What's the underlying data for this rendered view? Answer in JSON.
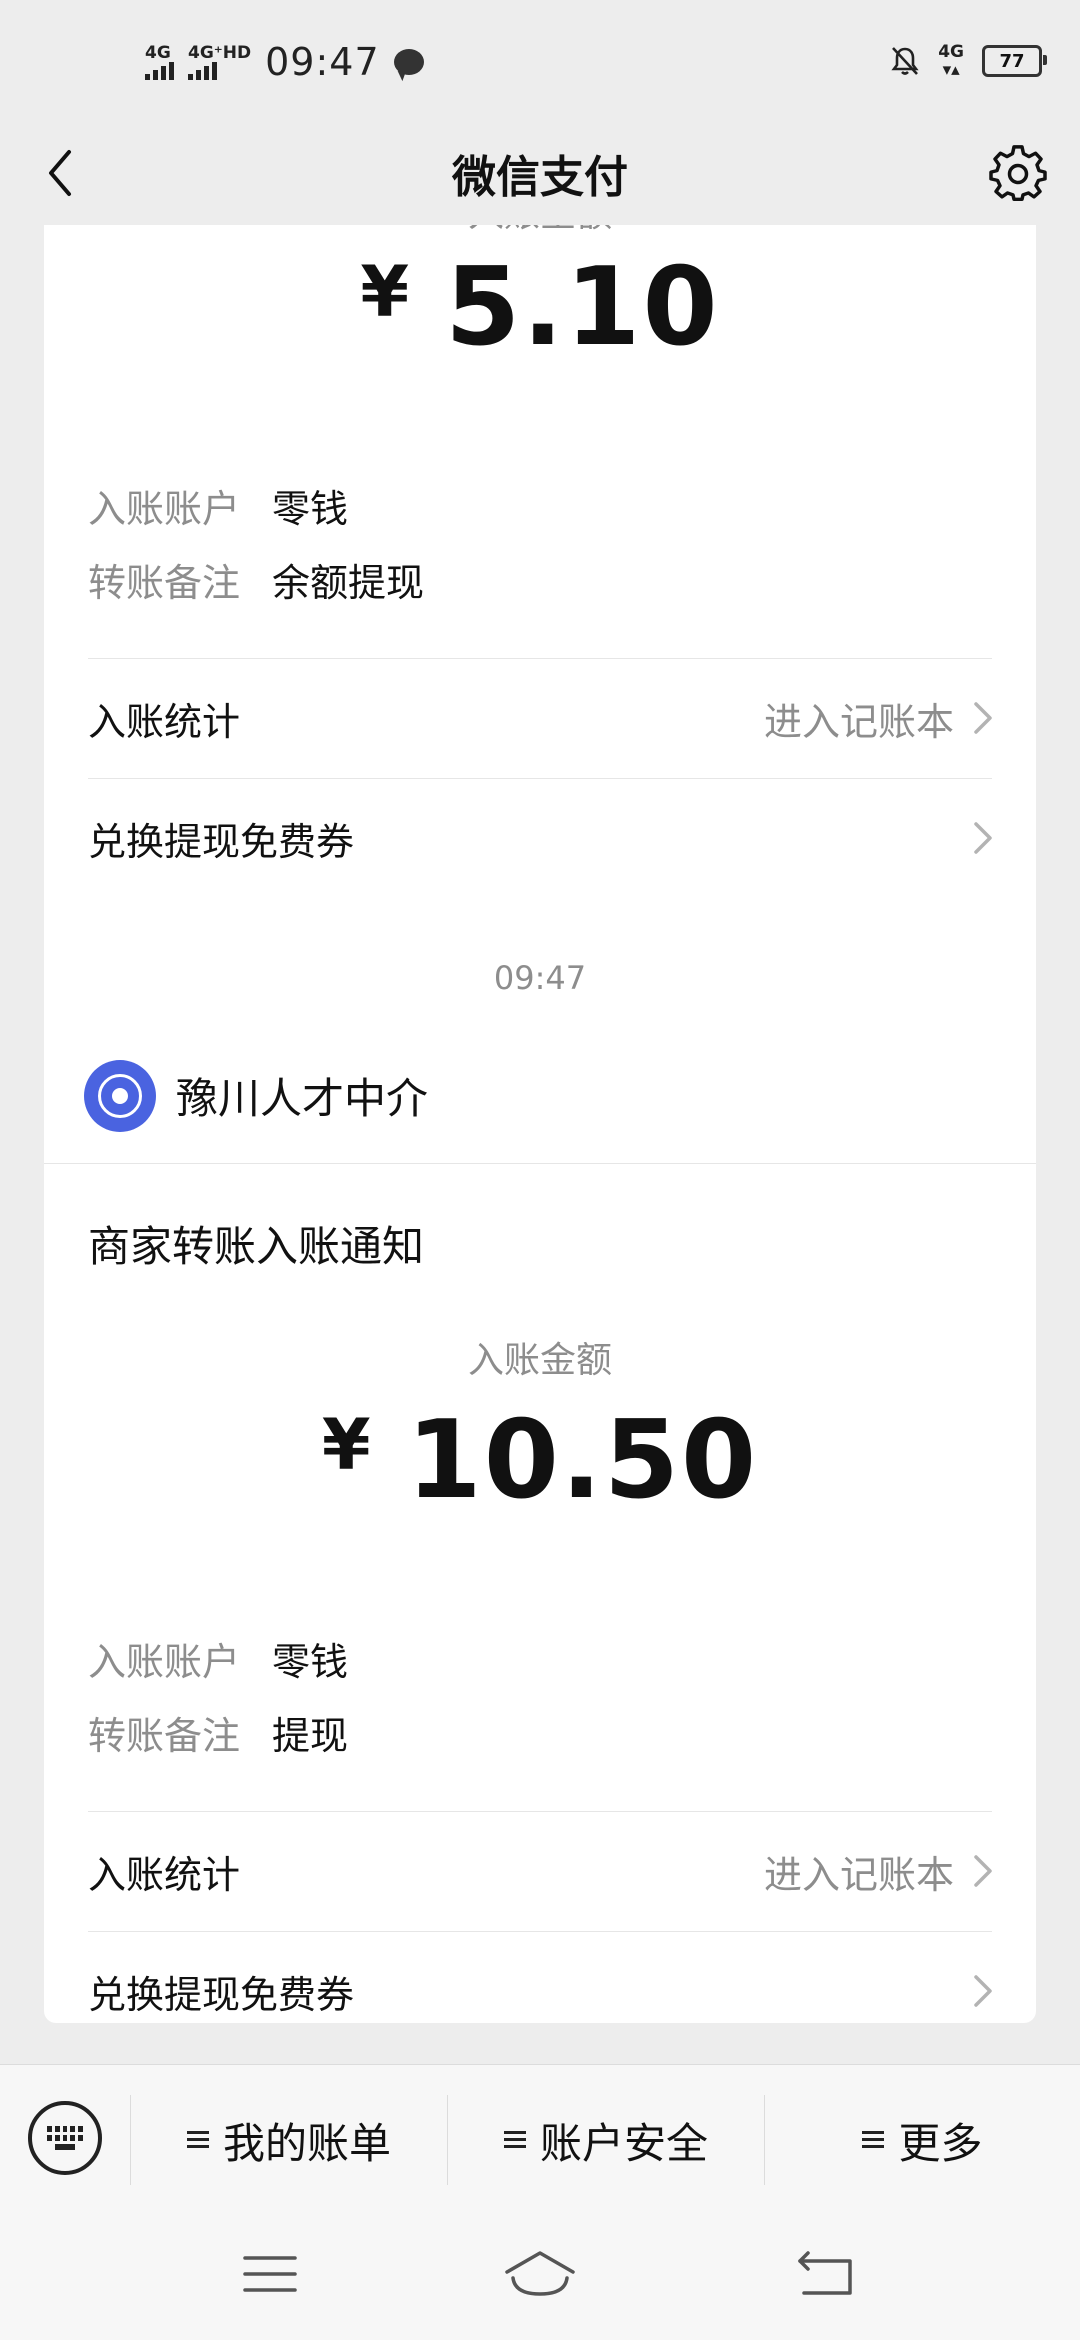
{
  "status_bar": {
    "time": "09:47",
    "signal1_label": "4G",
    "signal2_label": "4G⁺HD",
    "net_label": "4G",
    "battery": "77"
  },
  "nav": {
    "title": "微信支付"
  },
  "card1": {
    "amount_label": "入账金额",
    "currency": "¥",
    "amount": "5.10",
    "account_key": "入账账户",
    "account_value": "零钱",
    "remark_key": "转账备注",
    "remark_value": "余额提现",
    "stats_label": "入账统计",
    "stats_link": "进入记账本",
    "voucher_label": "兑换提现免费券"
  },
  "timestamp": "09:47",
  "card2": {
    "merchant_name": "豫川人才中介",
    "notice_title": "商家转账入账通知",
    "amount_label": "入账金额",
    "currency": "¥",
    "amount": "10.50",
    "account_key": "入账账户",
    "account_value": "零钱",
    "remark_key": "转账备注",
    "remark_value": "提现",
    "stats_label": "入账统计",
    "stats_link": "进入记账本",
    "voucher_label": "兑换提现免费券"
  },
  "bottom_menu": {
    "items": [
      "我的账单",
      "账户安全",
      "更多"
    ]
  },
  "icons": {
    "back": "back-arrow-icon",
    "settings": "gear-icon",
    "chevron": "chevron-right-icon",
    "keyboard": "keyboard-icon",
    "sys_menu": "menu-icon",
    "sys_home": "home-icon",
    "sys_back": "back-icon"
  }
}
